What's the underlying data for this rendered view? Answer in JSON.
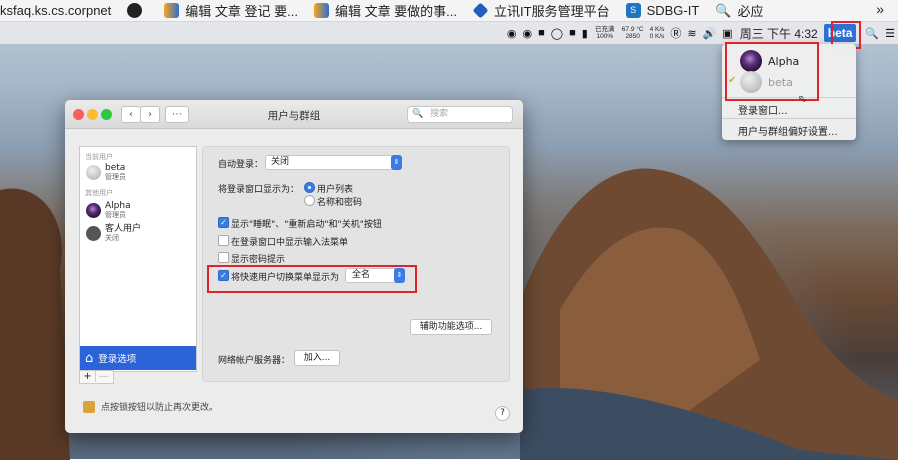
{
  "bookmarks": [
    {
      "label": "ksfaq.ks.cs.corpnet",
      "icon": "none"
    },
    {
      "label": "",
      "icon": "github-icon"
    },
    {
      "label": "编辑 文章 登记 要...",
      "icon": "jre-icon"
    },
    {
      "label": "编辑 文章 要做的事...",
      "icon": "jre-icon"
    },
    {
      "label": "立讯IT服务管理平台",
      "icon": "diamond-icon"
    },
    {
      "label": "SDBG-IT",
      "icon": "sharepoint-icon"
    },
    {
      "label": "必应",
      "icon": "search-icon"
    }
  ],
  "bookmarks_more": "»",
  "menubar": {
    "net_stats": [
      "67.9 °C",
      "2850",
      "4 K/s",
      "0 K/s"
    ],
    "battery_label": "已充满 100%",
    "clock": "周三 下午 4:32",
    "current_user": "beta"
  },
  "user_menu": {
    "users": [
      {
        "name": "Alpha",
        "active": true
      },
      {
        "name": "beta",
        "active": false
      }
    ],
    "items": [
      "登录窗口...",
      "用户与群组偏好设置..."
    ]
  },
  "window": {
    "title": "用户与群组",
    "search_placeholder": "搜索",
    "sidebar": {
      "current_header": "当前用户",
      "other_header": "其他用户",
      "current_user": {
        "name": "beta",
        "role": "管理员"
      },
      "other_users": [
        {
          "name": "Alpha",
          "role": "管理员"
        },
        {
          "name": "客人用户",
          "role": "关闭"
        }
      ],
      "login_options": "登录选项",
      "add": "+",
      "remove": "—"
    },
    "panel": {
      "auto_login_label": "自动登录：",
      "auto_login_value": "关闭",
      "display_as_label": "将登录窗口显示为：",
      "display_options": [
        "用户列表",
        "名称和密码"
      ],
      "checkboxes": [
        {
          "label": "显示\"睡眠\"、\"重新启动\"和\"关机\"按钮",
          "checked": true
        },
        {
          "label": "在登录窗口中显示输入法菜单",
          "checked": false
        },
        {
          "label": "显示密码提示",
          "checked": false
        },
        {
          "label": "将快速用户切换菜单显示为",
          "checked": true
        }
      ],
      "fast_switch_value": "全名",
      "accessibility_button": "辅助功能选项...",
      "network_server_label": "网络帐户服务器：",
      "join_button": "加入..."
    },
    "lock_text": "点按锁按钮以防止再次更改。",
    "help": "?"
  },
  "colors": {
    "highlight_box": "#e0242b",
    "accent": "#3a7be6"
  }
}
